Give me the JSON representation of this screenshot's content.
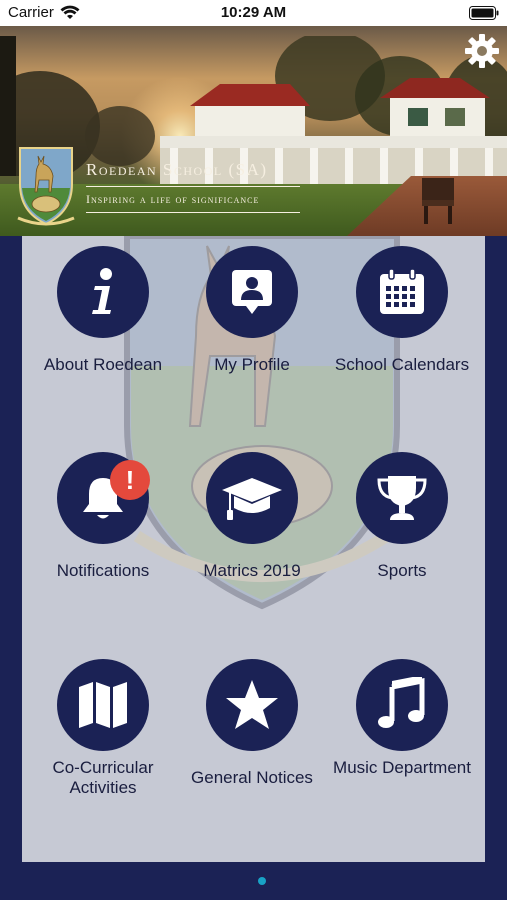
{
  "status_bar": {
    "carrier": "Carrier",
    "time": "10:29 AM"
  },
  "header": {
    "school_name": "Roedean School (SA)",
    "motto": "Inspiring a life of significance"
  },
  "tiles": [
    {
      "label": "About Roedean",
      "icon": "info-icon"
    },
    {
      "label": "My Profile",
      "icon": "profile-icon"
    },
    {
      "label": "School Calendars",
      "icon": "calendar-icon"
    },
    {
      "label": "Notifications",
      "icon": "bell-icon",
      "badge": "!"
    },
    {
      "label": "Matrics 2019",
      "icon": "graduation-cap-icon"
    },
    {
      "label": "Sports",
      "icon": "trophy-icon"
    },
    {
      "label": "Co-Curricular Activities",
      "icon": "map-icon"
    },
    {
      "label": "General Notices",
      "icon": "star-icon"
    },
    {
      "label": "Music Department",
      "icon": "music-note-icon"
    }
  ],
  "colors": {
    "navy": "#1b2255",
    "panel": "#c6c9d4",
    "badge": "#e4493c",
    "page_dot": "#19a3c6"
  }
}
